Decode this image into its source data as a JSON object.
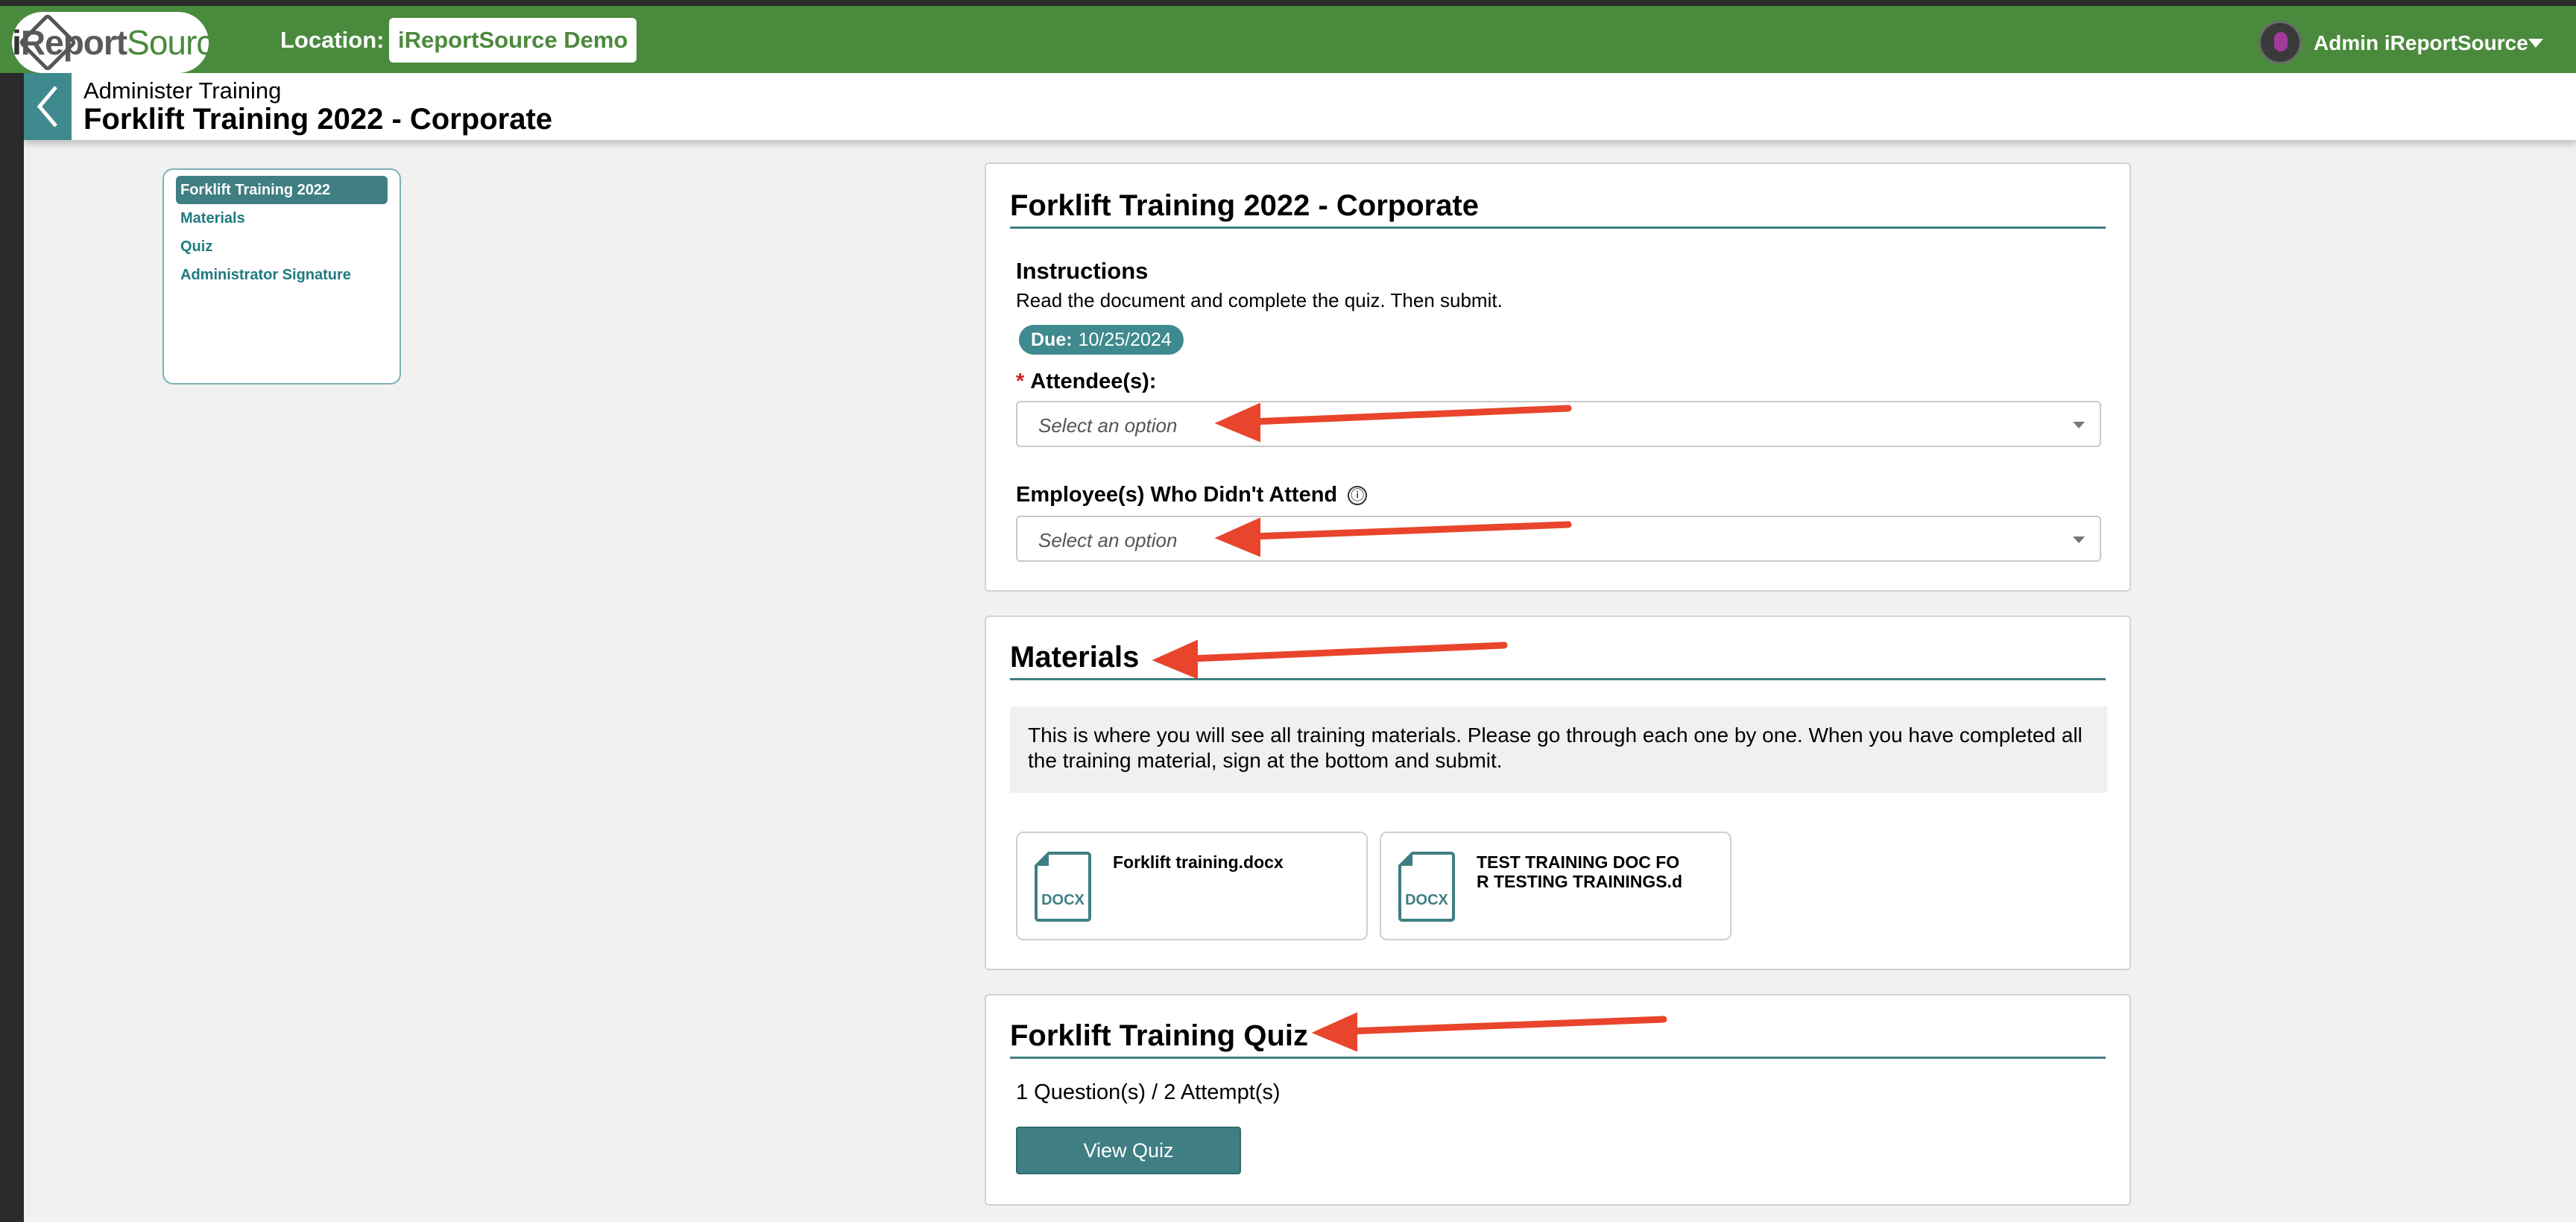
{
  "header": {
    "logo": {
      "i": "i",
      "report": "Report",
      "source": "Source"
    },
    "location_label": "Location:",
    "location_value": "iReportSource Demo",
    "user_name": "Admin iReportSource"
  },
  "titlebar": {
    "breadcrumb": "Administer Training",
    "title": "Forklift Training 2022 - Corporate"
  },
  "sidenav": {
    "items": [
      {
        "label": "Forklift Training 2022",
        "active": true
      },
      {
        "label": "Materials",
        "active": false
      },
      {
        "label": "Quiz",
        "active": false
      },
      {
        "label": "Administrator Signature",
        "active": false
      }
    ]
  },
  "training": {
    "title": "Forklift Training 2022 - Corporate",
    "instructions_label": "Instructions",
    "instructions_text": "Read the document and complete the quiz. Then submit.",
    "due_label": "Due:",
    "due_date": "10/25/2024",
    "attendees_required_mark": "*",
    "attendees_label": "Attendee(s):",
    "attendees_placeholder": "Select an option",
    "absent_label": "Employee(s) Who Didn't Attend",
    "absent_info_icon": "ⓘ",
    "absent_placeholder": "Select an option"
  },
  "materials": {
    "title": "Materials",
    "description": "This is where you will see all training materials. Please go through each one by one. When you have completed all the training material, sign at the bottom and submit.",
    "files": [
      {
        "name": "Forklift training.docx",
        "type": "DOCX"
      },
      {
        "name": "TEST TRAINING DOC FOR TESTING TRAININGS.d",
        "type": "DOCX"
      }
    ]
  },
  "quiz": {
    "title": "Forklift Training Quiz",
    "meta": "1 Question(s) / 2 Attempt(s)",
    "button_label": "View Quiz"
  },
  "colors": {
    "header_green": "#4a8a3c",
    "teal": "#3f7f83",
    "arrow_red": "#e8452c"
  }
}
